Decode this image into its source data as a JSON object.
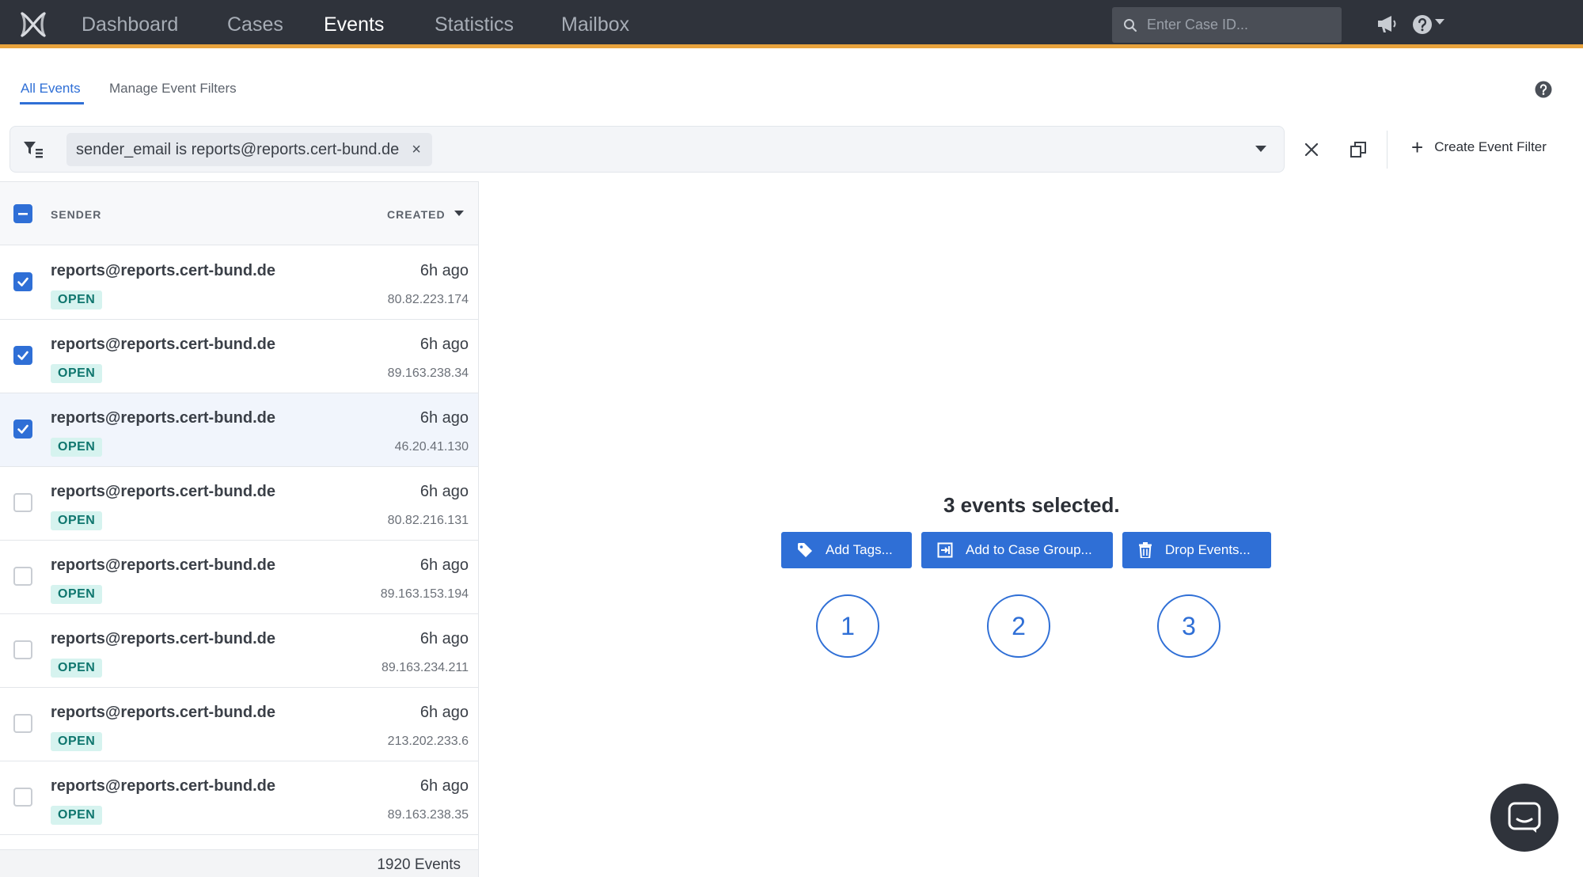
{
  "nav": {
    "items": [
      {
        "label": "Dashboard",
        "active": false
      },
      {
        "label": "Cases",
        "active": false
      },
      {
        "label": "Events",
        "active": true
      },
      {
        "label": "Statistics",
        "active": false
      },
      {
        "label": "Mailbox",
        "active": false
      }
    ],
    "search_placeholder": "Enter Case ID...",
    "icons": [
      "logo-icon",
      "search-icon",
      "megaphone-icon",
      "help-icon",
      "caret-down-icon"
    ]
  },
  "subtabs": [
    {
      "label": "All Events",
      "active": true
    },
    {
      "label": "Manage Event Filters",
      "active": false
    }
  ],
  "filter": {
    "chip_label": "sender_email is reports@reports.cert-bund.de",
    "chip_remove": "×",
    "create_label": "Create Event Filter",
    "create_plus": "+"
  },
  "list": {
    "header": {
      "sender": "SENDER",
      "created": "CREATED"
    },
    "rows": [
      {
        "sender": "reports@reports.cert-bund.de",
        "time": "6h ago",
        "status": "OPEN",
        "ip": "80.82.223.174",
        "checked": true,
        "highlight": false
      },
      {
        "sender": "reports@reports.cert-bund.de",
        "time": "6h ago",
        "status": "OPEN",
        "ip": "89.163.238.34",
        "checked": true,
        "highlight": false
      },
      {
        "sender": "reports@reports.cert-bund.de",
        "time": "6h ago",
        "status": "OPEN",
        "ip": "46.20.41.130",
        "checked": true,
        "highlight": true
      },
      {
        "sender": "reports@reports.cert-bund.de",
        "time": "6h ago",
        "status": "OPEN",
        "ip": "80.82.216.131",
        "checked": false,
        "highlight": false
      },
      {
        "sender": "reports@reports.cert-bund.de",
        "time": "6h ago",
        "status": "OPEN",
        "ip": "89.163.153.194",
        "checked": false,
        "highlight": false
      },
      {
        "sender": "reports@reports.cert-bund.de",
        "time": "6h ago",
        "status": "OPEN",
        "ip": "89.163.234.211",
        "checked": false,
        "highlight": false
      },
      {
        "sender": "reports@reports.cert-bund.de",
        "time": "6h ago",
        "status": "OPEN",
        "ip": "213.202.233.6",
        "checked": false,
        "highlight": false
      },
      {
        "sender": "reports@reports.cert-bund.de",
        "time": "6h ago",
        "status": "OPEN",
        "ip": "89.163.238.35",
        "checked": false,
        "highlight": false
      }
    ],
    "footer": "1920 Events"
  },
  "selection": {
    "title": "3 events selected.",
    "actions": [
      {
        "label": "Add Tags...",
        "icon": "tag-icon"
      },
      {
        "label": "Add to Case Group...",
        "icon": "add-to-group-icon"
      },
      {
        "label": "Drop Events...",
        "icon": "trash-icon"
      }
    ],
    "callouts": [
      "1",
      "2",
      "3"
    ]
  },
  "colors": {
    "nav_bg": "#2f333b",
    "nav_accent": "#e8a33d",
    "primary": "#2f6fd6",
    "badge_bg": "#d6f3ef",
    "badge_text": "#0f766e"
  }
}
